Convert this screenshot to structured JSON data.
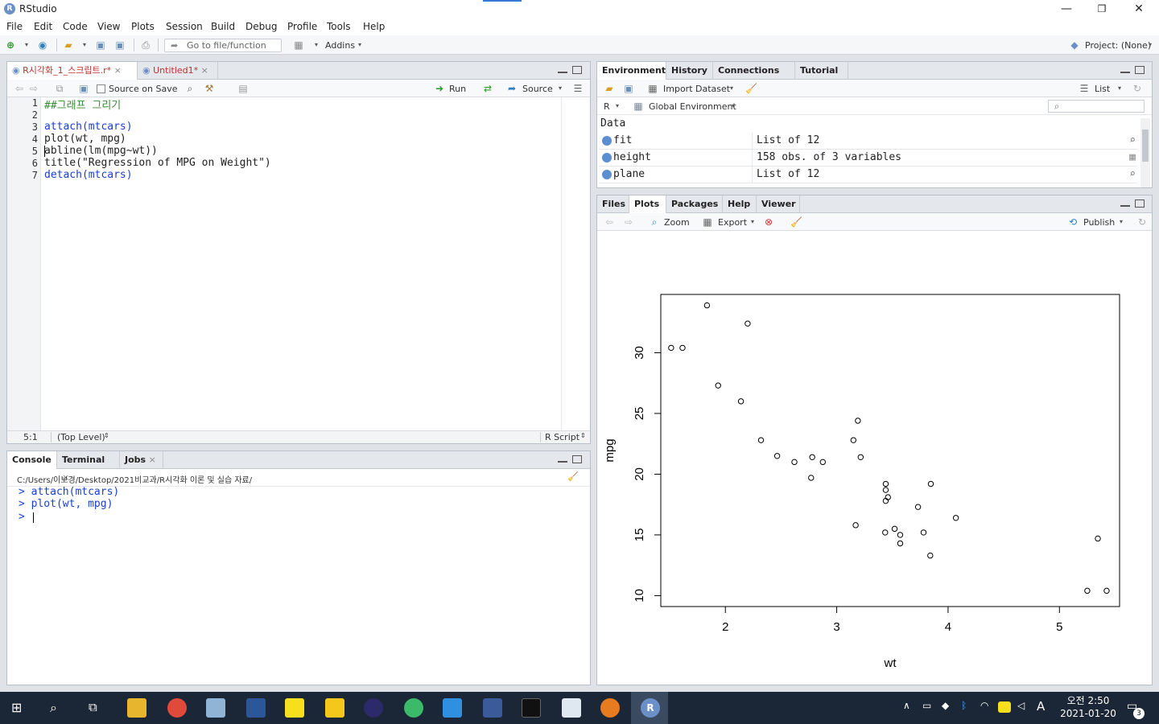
{
  "window": {
    "title": "RStudio"
  },
  "menu": [
    "File",
    "Edit",
    "Code",
    "View",
    "Plots",
    "Session",
    "Build",
    "Debug",
    "Profile",
    "Tools",
    "Help"
  ],
  "toolbar": {
    "goto_placeholder": "Go to file/function",
    "addins": "Addins",
    "project": "Project: (None)"
  },
  "editor": {
    "tabs": [
      "R시각화_1_스크립트.r*",
      "Untitled1*"
    ],
    "source_on_save": "Source on Save",
    "run": "Run",
    "source": "Source",
    "lines": [
      "##그래프 그리기",
      "",
      "attach(mtcars)",
      "plot(wt, mpg)",
      "abline(lm(mpg~wt))",
      "title(\"Regression of MPG on Weight\")",
      "detach(mtcars)"
    ],
    "line_numbers": [
      "1",
      "2",
      "3",
      "4",
      "5",
      "6",
      "7"
    ],
    "status": {
      "position": "5:1",
      "scope": "(Top Level)",
      "type": "R Script"
    }
  },
  "console": {
    "tabs": [
      "Console",
      "Terminal",
      "Jobs"
    ],
    "path": "C:/Users/이보경/Desktop/2021비교과/R시각화 이론 및 실습 자료/",
    "lines": [
      "> attach(mtcars)",
      "> plot(wt, mpg)",
      "> "
    ]
  },
  "environment": {
    "tabs": [
      "Environment",
      "History",
      "Connections",
      "Tutorial"
    ],
    "import": "Import Dataset",
    "list": "List",
    "lang": "R",
    "scope": "Global Environment",
    "section": "Data",
    "rows": [
      {
        "name": "fit",
        "value": "List of  12"
      },
      {
        "name": "height",
        "value": "158 obs. of 3 variables"
      },
      {
        "name": "plane",
        "value": "List of  12"
      }
    ]
  },
  "files": {
    "tabs": [
      "Files",
      "Plots",
      "Packages",
      "Help",
      "Viewer"
    ],
    "zoom": "Zoom",
    "export": "Export",
    "publish": "Publish"
  },
  "chart_data": {
    "type": "scatter",
    "xlabel": "wt",
    "ylabel": "mpg",
    "xlim": [
      1.42,
      5.54
    ],
    "ylim": [
      9.1,
      34.8
    ],
    "xticks": [
      2,
      3,
      4,
      5
    ],
    "yticks": [
      10,
      15,
      20,
      25,
      30
    ],
    "points": [
      [
        2.62,
        21.0
      ],
      [
        2.875,
        21.0
      ],
      [
        2.32,
        22.8
      ],
      [
        3.215,
        21.4
      ],
      [
        3.44,
        18.7
      ],
      [
        3.46,
        18.1
      ],
      [
        3.57,
        14.3
      ],
      [
        3.19,
        24.4
      ],
      [
        3.15,
        22.8
      ],
      [
        3.44,
        19.2
      ],
      [
        3.44,
        17.8
      ],
      [
        4.07,
        16.4
      ],
      [
        3.73,
        17.3
      ],
      [
        3.78,
        15.2
      ],
      [
        5.25,
        10.4
      ],
      [
        5.424,
        10.4
      ],
      [
        5.345,
        14.7
      ],
      [
        2.2,
        32.4
      ],
      [
        1.615,
        30.4
      ],
      [
        1.835,
        33.9
      ],
      [
        2.465,
        21.5
      ],
      [
        3.52,
        15.5
      ],
      [
        3.435,
        15.2
      ],
      [
        3.84,
        13.3
      ],
      [
        3.845,
        19.2
      ],
      [
        1.935,
        27.3
      ],
      [
        2.14,
        26.0
      ],
      [
        1.513,
        30.4
      ],
      [
        3.17,
        15.8
      ],
      [
        2.77,
        19.7
      ],
      [
        3.57,
        15.0
      ],
      [
        2.78,
        21.4
      ]
    ]
  },
  "taskbar": {
    "time": "오전 2:50",
    "date": "2021-01-20",
    "ime": "A",
    "notifications": "3"
  }
}
